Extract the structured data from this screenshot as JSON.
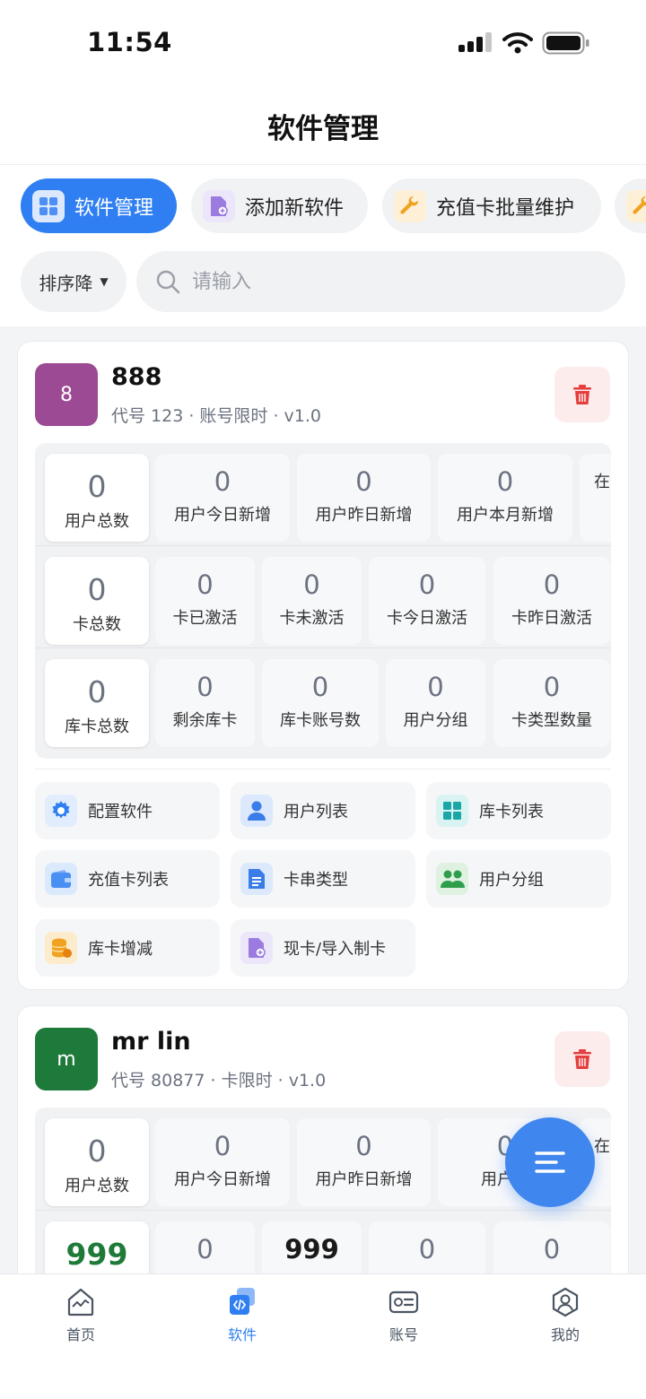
{
  "status": {
    "time": "11:54"
  },
  "header": {
    "title": "软件管理"
  },
  "tabs": [
    {
      "label": "软件管理",
      "active": true,
      "icon": "grid-icon"
    },
    {
      "label": "添加新软件",
      "active": false,
      "icon": "file-add-icon"
    },
    {
      "label": "充值卡批量维护",
      "active": false,
      "icon": "wrench-icon"
    }
  ],
  "filter": {
    "sort_label": "排序降",
    "search_placeholder": "请输入"
  },
  "cards": [
    {
      "avatar": "8",
      "avatar_color": "#9c4a93",
      "name": "888",
      "meta": "代号 123 · 账号限时 · v1.0",
      "stat_rows": [
        [
          {
            "value": "0",
            "label": "用户总数"
          },
          {
            "value": "0",
            "label": "用户今日新增"
          },
          {
            "value": "0",
            "label": "用户昨日新增"
          },
          {
            "value": "0",
            "label": "用户本月新增"
          },
          {
            "value": "",
            "label": "在"
          }
        ],
        [
          {
            "value": "0",
            "label": "卡总数"
          },
          {
            "value": "0",
            "label": "卡已激活"
          },
          {
            "value": "0",
            "label": "卡未激活"
          },
          {
            "value": "0",
            "label": "卡今日激活"
          },
          {
            "value": "0",
            "label": "卡昨日激活"
          }
        ],
        [
          {
            "value": "0",
            "label": "库卡总数"
          },
          {
            "value": "0",
            "label": "剩余库卡"
          },
          {
            "value": "0",
            "label": "库卡账号数"
          },
          {
            "value": "0",
            "label": "用户分组"
          },
          {
            "value": "0",
            "label": "卡类型数量"
          }
        ]
      ],
      "actions": [
        {
          "label": "配置软件",
          "icon": "gear-icon"
        },
        {
          "label": "用户列表",
          "icon": "user-icon"
        },
        {
          "label": "库卡列表",
          "icon": "grid-icon"
        },
        {
          "label": "充值卡列表",
          "icon": "wallet-icon"
        },
        {
          "label": "卡串类型",
          "icon": "document-icon"
        },
        {
          "label": "用户分组",
          "icon": "users-icon"
        },
        {
          "label": "库卡增减",
          "icon": "coins-icon"
        },
        {
          "label": "现卡/导入制卡",
          "icon": "file-add-icon"
        }
      ]
    },
    {
      "avatar": "m",
      "avatar_color": "#1e7a3a",
      "name": "mr lin",
      "meta": "代号 80877 · 卡限时 · v1.0",
      "stat_rows": [
        [
          {
            "value": "0",
            "label": "用户总数"
          },
          {
            "value": "0",
            "label": "用户今日新增"
          },
          {
            "value": "0",
            "label": "用户昨日新增"
          },
          {
            "value": "0",
            "label": "用户本"
          },
          {
            "value": "",
            "label": "在"
          }
        ],
        [
          {
            "value": "999",
            "label": ""
          },
          {
            "value": "0",
            "label": ""
          },
          {
            "value": "999",
            "label": ""
          },
          {
            "value": "0",
            "label": ""
          },
          {
            "value": "0",
            "label": ""
          }
        ]
      ]
    }
  ],
  "nav": [
    {
      "label": "首页",
      "icon": "home-chart-icon",
      "active": false
    },
    {
      "label": "软件",
      "icon": "code-icon",
      "active": true
    },
    {
      "label": "账号",
      "icon": "id-card-icon",
      "active": false
    },
    {
      "label": "我的",
      "icon": "profile-icon",
      "active": false
    }
  ],
  "colors": {
    "accent": "#2f7ff2",
    "danger": "#e53e3e",
    "value_green": "#1f7a3a"
  }
}
